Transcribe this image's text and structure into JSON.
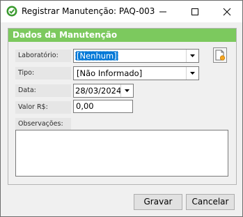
{
  "window": {
    "title": "Registrar Manutenção: PAQ-003"
  },
  "panel": {
    "header": "Dados da Manutenção"
  },
  "form": {
    "laboratorio": {
      "label": "Laboratório:",
      "value": "[Nenhum]"
    },
    "tipo": {
      "label": "Tipo:",
      "value": "[Não Informado]"
    },
    "data": {
      "label": "Data:",
      "value": "28/03/2024"
    },
    "valor": {
      "label": "Valor R$:",
      "value": "0,00"
    },
    "observacoes": {
      "label": "Observações:",
      "value": ""
    }
  },
  "buttons": {
    "save": "Gravar",
    "cancel": "Cancelar"
  },
  "colors": {
    "header_green": "#7cc95e",
    "selection_blue": "#0078d7"
  }
}
